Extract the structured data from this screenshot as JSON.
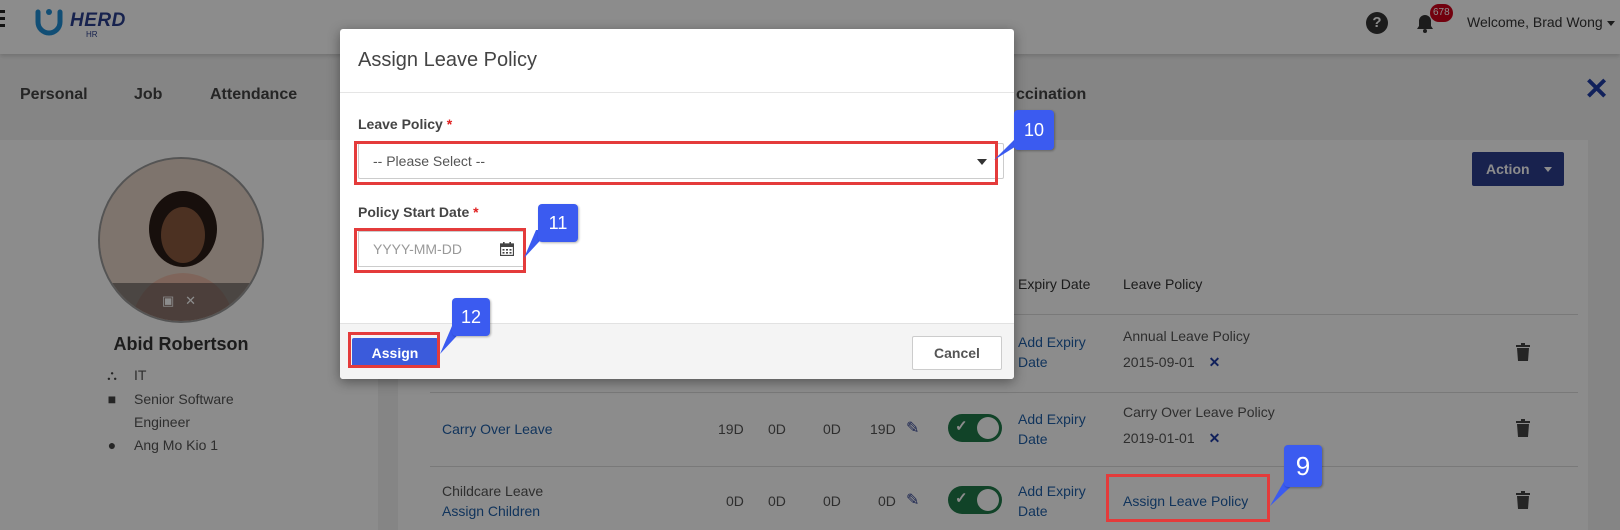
{
  "header": {
    "logo_text": "HERD",
    "logo_sub": "HR",
    "help_icon": "?",
    "notification_count": "678",
    "welcome_text": "Welcome, Brad Wong"
  },
  "tabs": [
    "Personal",
    "Job",
    "Attendance"
  ],
  "tab_partial": "ccination",
  "close_icon": "✕",
  "employee": {
    "name": "Abid Robertson",
    "department": "IT",
    "title_line1": "Senior Software",
    "title_line2": "Engineer",
    "location": "Ang Mo Kio 1"
  },
  "action_button": "Action",
  "table": {
    "headers": {
      "expiry": "Expiry Date",
      "policy": "Leave Policy"
    },
    "rows": [
      {
        "name": "",
        "sub": "",
        "v1": "",
        "v2": "",
        "v3": "",
        "v4": "",
        "expiry_line1": "Add Expiry",
        "expiry_line2": "Date",
        "policy": "Annual Leave Policy",
        "policy_date": "2015-09-01"
      },
      {
        "name": "Carry Over Leave",
        "sub": "",
        "v1": "19D",
        "v2": "0D",
        "v3": "0D",
        "v4": "19D",
        "expiry_line1": "Add Expiry",
        "expiry_line2": "Date",
        "policy": "Carry Over Leave Policy",
        "policy_date": "2019-01-01"
      },
      {
        "name": "Childcare Leave",
        "sub": "Assign Children",
        "v1": "0D",
        "v2": "0D",
        "v3": "0D",
        "v4": "0D",
        "expiry_line1": "Add Expiry",
        "expiry_line2": "Date",
        "policy": "Assign Leave Policy",
        "policy_date": ""
      }
    ]
  },
  "modal": {
    "title": "Assign Leave Policy",
    "leave_policy_label": "Leave Policy",
    "leave_policy_value": "-- Please Select --",
    "start_date_label": "Policy Start Date",
    "start_date_placeholder": "YYYY-MM-DD",
    "required_mark": "*",
    "assign_label": "Assign",
    "cancel_label": "Cancel"
  },
  "callouts": {
    "c9": "9",
    "c10": "10",
    "c11": "11",
    "c12": "12"
  },
  "colors": {
    "primary": "#3b5bdb",
    "callout": "#3b5bf0",
    "highlight": "#e43b3b",
    "nav_dark": "#2c3e8f"
  }
}
